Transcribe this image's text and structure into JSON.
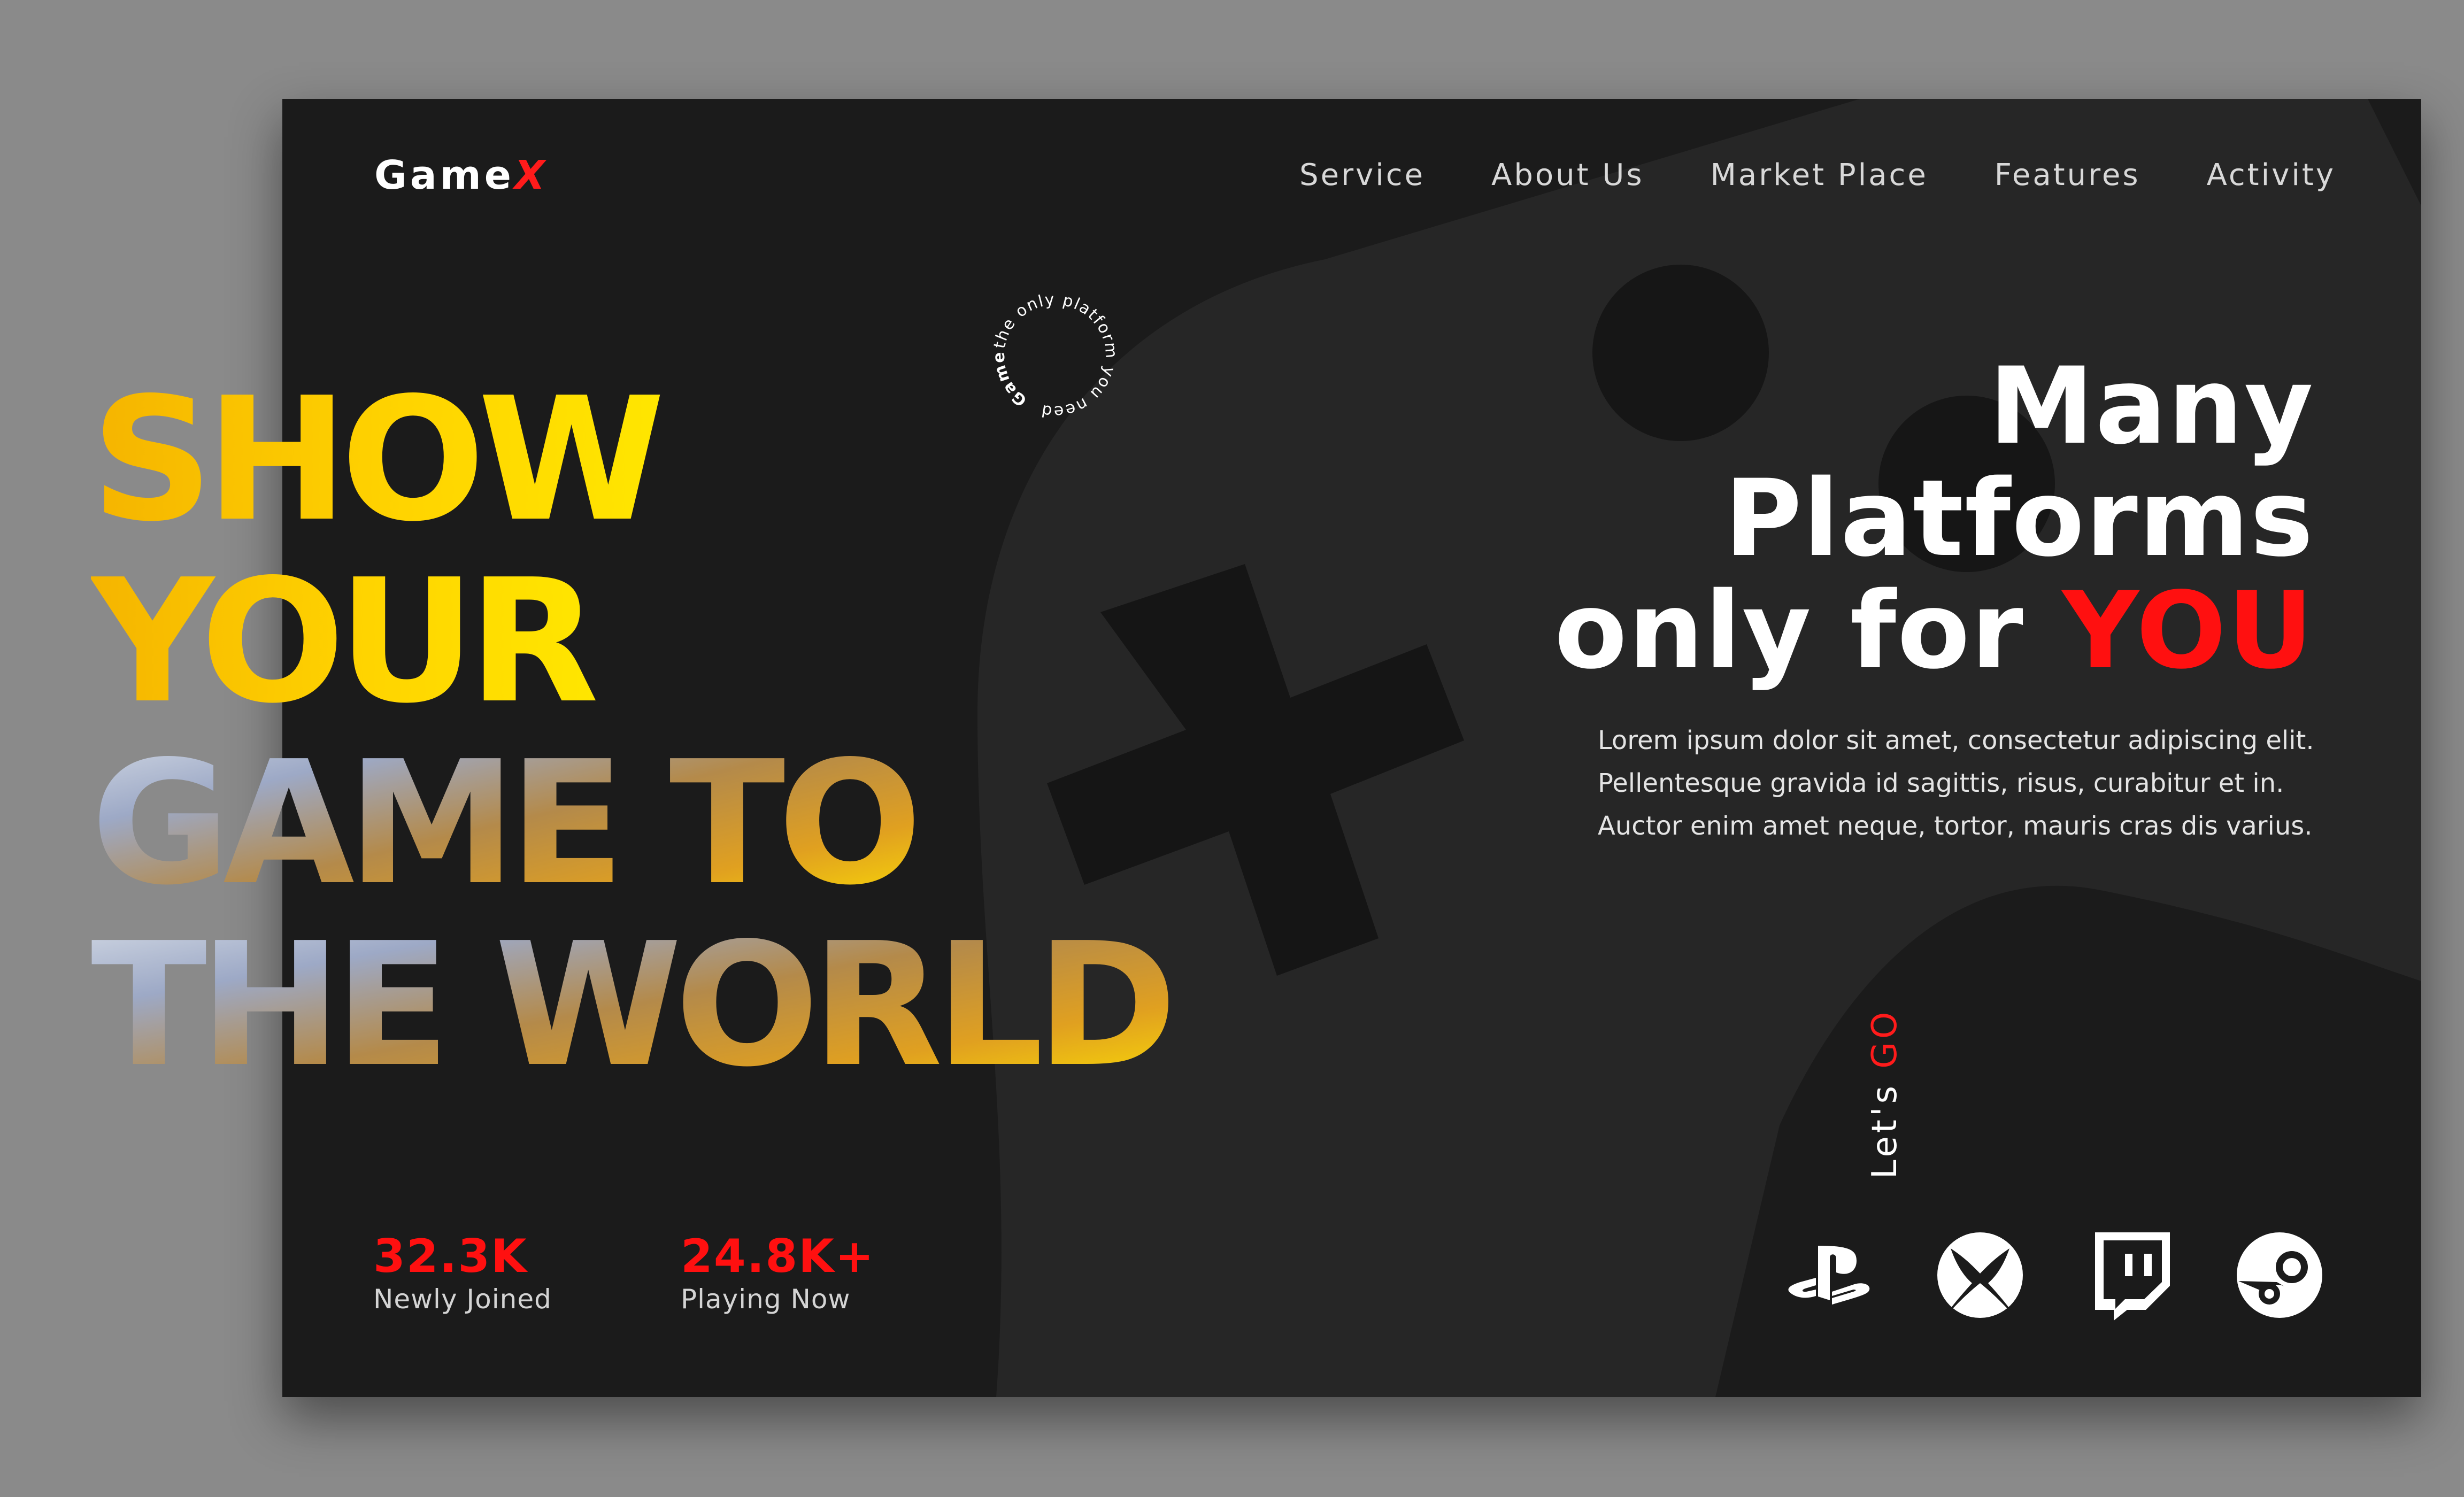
{
  "brand": {
    "name": "Game",
    "accent_letter": "X"
  },
  "nav": {
    "items": [
      {
        "label": "Service"
      },
      {
        "label": "About Us"
      },
      {
        "label": "Market Place"
      },
      {
        "label": "Features"
      },
      {
        "label": "Activity"
      }
    ]
  },
  "badge": {
    "ring_text": "the only platform you need",
    "ring_brand": "GameX"
  },
  "hero": {
    "lines": [
      "SHOW",
      "YOUR",
      "GAME TO",
      "THE WORLD"
    ]
  },
  "tagline": {
    "line1": "Many",
    "line2": "Platforms",
    "line3_prefix": "only for ",
    "line3_highlight": "YOU"
  },
  "description": "Lorem ipsum dolor sit amet, consectetur adipiscing elit.\nPellentesque gravida id sagittis, risus, curabitur et in.\nAuctor enim amet neque, tortor, mauris cras dis varius.",
  "cta": {
    "lets": "Let's ",
    "go": "GO"
  },
  "stats": [
    {
      "value": "32.3K",
      "label": "Newly Joined"
    },
    {
      "value": "24.8K+",
      "label": "Playing Now"
    }
  ],
  "platform_icons": [
    "playstation-icon",
    "xbox-icon",
    "twitch-icon",
    "steam-icon"
  ],
  "colors": {
    "background": "#1b1b1b",
    "accent_red": "#ff1010",
    "hero_yellow": "#ffd400",
    "hero_orange": "#f5b400",
    "outer": "#8a8a8a"
  }
}
